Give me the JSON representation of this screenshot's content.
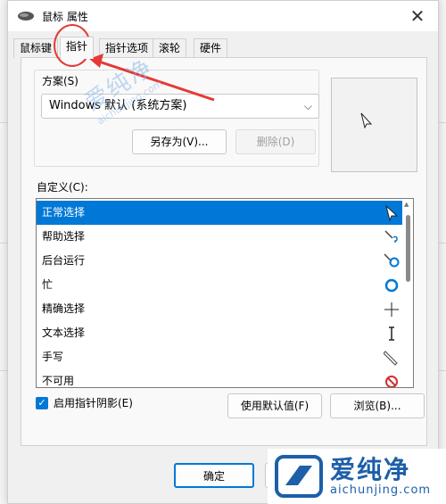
{
  "window": {
    "title": "鼠标 属性",
    "close_glyph": "✕"
  },
  "tabs": [
    {
      "label": "鼠标键",
      "active": false
    },
    {
      "label": "指针",
      "active": true
    },
    {
      "label": "指针选项",
      "active": false
    },
    {
      "label": "滚轮",
      "active": false
    },
    {
      "label": "硬件",
      "active": false
    }
  ],
  "scheme": {
    "label": "方案(S)",
    "selected": "Windows 默认 (系统方案)",
    "chevron": "⌵",
    "save_as": "另存为(V)...",
    "delete": "删除(D)"
  },
  "custom": {
    "label": "自定义(C):",
    "items": [
      {
        "label": "正常选择",
        "icon": "arrow-cursor-icon",
        "selected": true
      },
      {
        "label": "帮助选择",
        "icon": "help-cursor-icon",
        "selected": false
      },
      {
        "label": "后台运行",
        "icon": "working-in-background-cursor-icon",
        "selected": false
      },
      {
        "label": "忙",
        "icon": "busy-cursor-icon",
        "selected": false
      },
      {
        "label": "精确选择",
        "icon": "crosshair-cursor-icon",
        "selected": false
      },
      {
        "label": "文本选择",
        "icon": "ibeam-cursor-icon",
        "selected": false
      },
      {
        "label": "手写",
        "icon": "pen-cursor-icon",
        "selected": false
      },
      {
        "label": "不可用",
        "icon": "unavailable-cursor-icon",
        "selected": false
      }
    ]
  },
  "shadow_checkbox": {
    "label": "启用指针阴影(E)",
    "checked": true,
    "check_glyph": "✓"
  },
  "buttons": {
    "use_default": "使用默认值(F)",
    "browse": "浏览(B)...",
    "ok": "确定"
  },
  "watermark": {
    "cn": "爱纯净",
    "en": "aichunjing.com"
  },
  "brand": {
    "cn": "爱纯净",
    "en": "aichunjing.com"
  },
  "colors": {
    "accent": "#0078d7",
    "annotation": "#e53935",
    "brand": "#1d5fa8"
  }
}
